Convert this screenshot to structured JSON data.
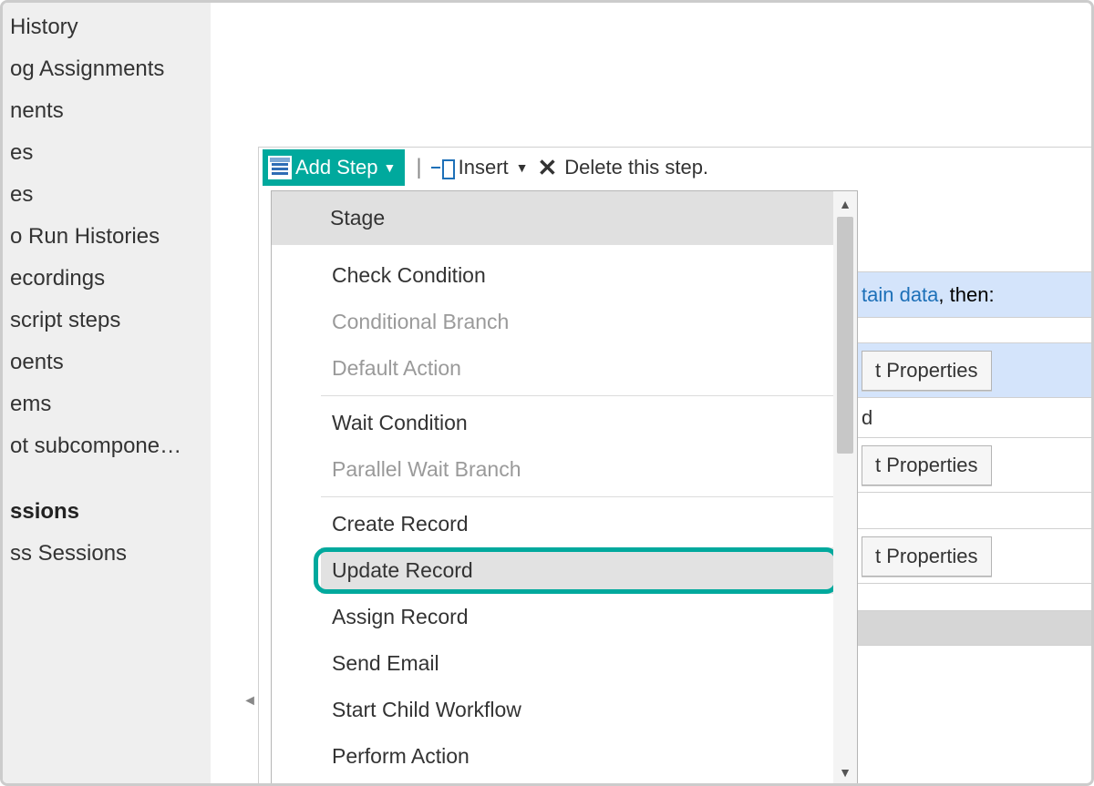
{
  "sidebar": {
    "items": [
      "History",
      "og Assignments",
      "nents",
      "es",
      "es",
      "o Run Histories",
      "ecordings",
      "script steps",
      "oents",
      "ems",
      "ot subcompone…"
    ],
    "section_label": "ssions",
    "subitem": "ss Sessions"
  },
  "toolbar": {
    "add_step": "Add Step",
    "insert": "Insert",
    "delete_text": "Delete this step."
  },
  "dropdown": {
    "stage": "Stage",
    "group1": [
      "Check Condition",
      "Conditional Branch",
      "Default Action"
    ],
    "group2": [
      "Wait Condition",
      "Parallel Wait Branch"
    ],
    "group3": [
      "Create Record",
      "Update Record",
      "Assign Record",
      "Send Email",
      "Start Child Workflow",
      "Perform Action"
    ]
  },
  "peek": {
    "cond_text": "tain data",
    "then": ", then:",
    "btn1": "t Properties",
    "mid_char": "d",
    "btn2": "t Properties",
    "btn3": "t Properties"
  }
}
